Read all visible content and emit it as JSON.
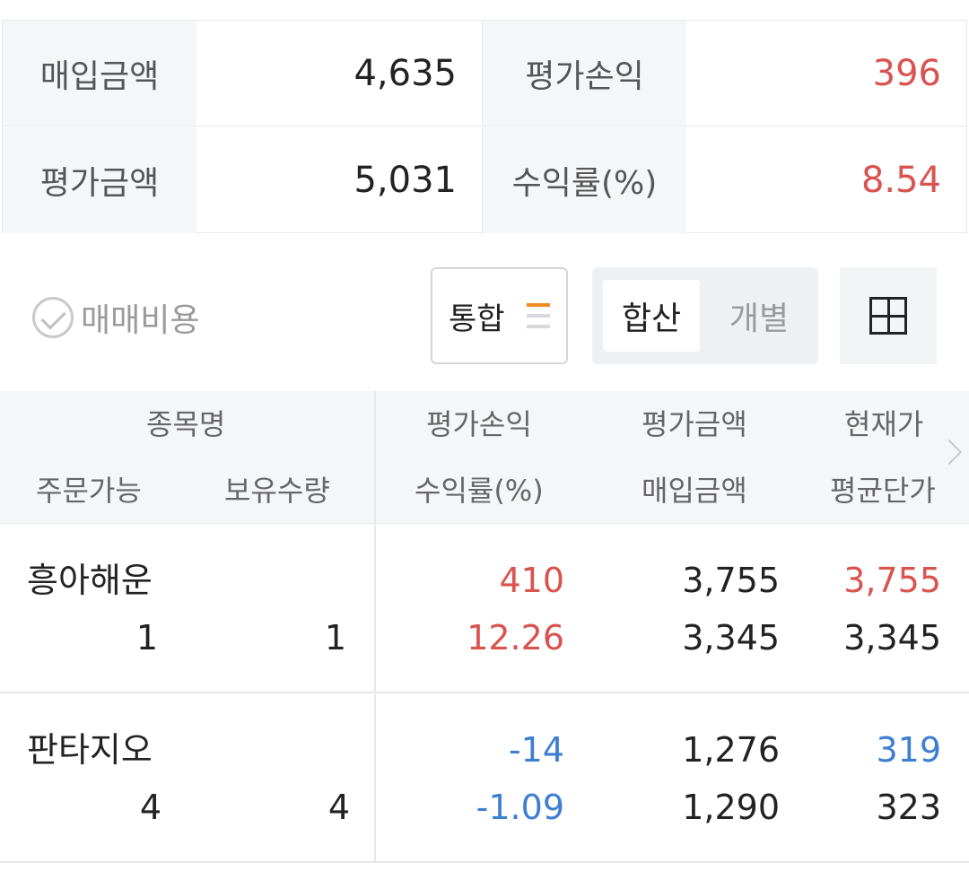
{
  "summary": {
    "purchase_label": "매입금액",
    "purchase_value": "4,635",
    "pl_label": "평가손익",
    "pl_value": "396",
    "eval_label": "평가금액",
    "eval_value": "5,031",
    "rate_label": "수익률(%)",
    "rate_value": "8.54"
  },
  "controls": {
    "fee_label": "매매비용",
    "combo_label": "통합",
    "seg_sum": "합산",
    "seg_individual": "개별"
  },
  "table": {
    "headers": {
      "name": "종목명",
      "orderable": "주문가능",
      "holding": "보유수량",
      "pl": "평가손익",
      "rate": "수익률(%)",
      "eval": "평가금액",
      "purchase": "매입금액",
      "current": "현재가",
      "avg": "평균단가"
    },
    "rows": [
      {
        "name": "흥아해운",
        "orderable": "1",
        "holding": "1",
        "pl": "410",
        "rate": "12.26",
        "eval": "3,755",
        "purchase": "3,345",
        "current": "3,755",
        "avg": "3,345"
      },
      {
        "name": "판타지오",
        "orderable": "4",
        "holding": "4",
        "pl": "-14",
        "rate": "-1.09",
        "eval": "1,276",
        "purchase": "1,290",
        "current": "319",
        "avg": "323"
      }
    ]
  },
  "colors": {
    "up": "#d9534f",
    "down": "#3d7fd0",
    "accent": "#f08c1e"
  }
}
